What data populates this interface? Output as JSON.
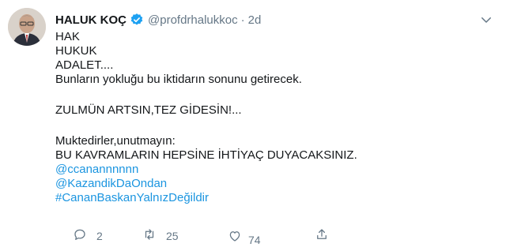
{
  "author": {
    "name": "HALUK KOÇ",
    "handle": "@profdrhalukkoc",
    "separator": "·",
    "time": "2d"
  },
  "tweet": {
    "lines": [
      "HAK",
      "HUKUK",
      "ADALET....",
      "Bunların yokluğu bu iktidarın sonunu getirecek."
    ],
    "line2": "ZULMÜN ARTSIN,TEZ GİDESİN!...",
    "lines3": [
      "Muktedirler,unutmayın:",
      "BU KAVRAMLARIN HEPSİNE İHTİYAÇ DUYACAKSINIZ."
    ],
    "mentions": [
      "@ccanannnnnn",
      "@KazandikDaOndan"
    ],
    "hashtag": "#CananBaskanYalnızDeğildir"
  },
  "actions": {
    "reply_count": "2",
    "retweet_count": "25",
    "like_count": "74"
  },
  "colors": {
    "link": "#1b95e0",
    "verified": "#1da1f2",
    "muted": "#657786"
  }
}
